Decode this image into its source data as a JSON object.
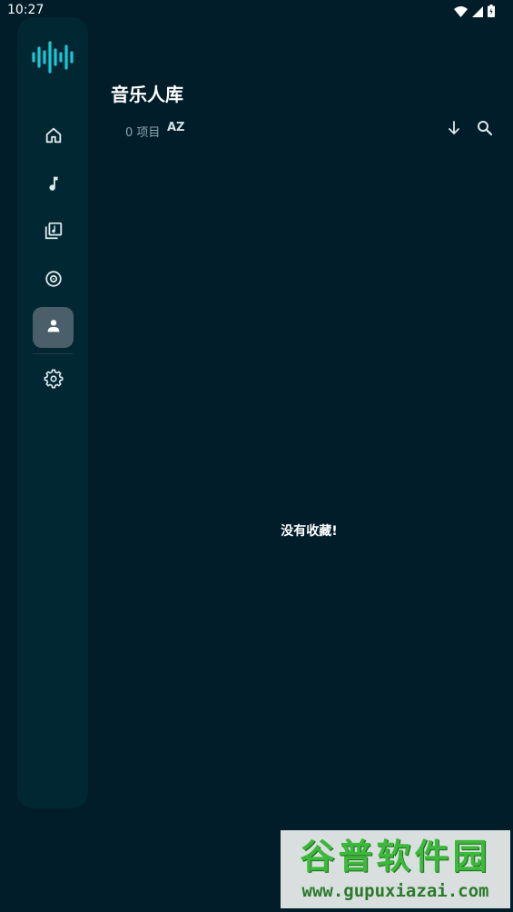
{
  "status_bar": {
    "time": "10:27",
    "icons": [
      "wifi-icon",
      "signal-icon",
      "battery-icon"
    ]
  },
  "sidebar": {
    "logo": "waveform-logo",
    "items": [
      {
        "id": "home",
        "icon": "home-icon",
        "active": false
      },
      {
        "id": "songs",
        "icon": "music-note-icon",
        "active": false
      },
      {
        "id": "playlists",
        "icon": "playlist-icon",
        "active": false
      },
      {
        "id": "albums",
        "icon": "album-icon",
        "active": false
      },
      {
        "id": "artists",
        "icon": "person-icon",
        "active": true
      },
      {
        "id": "settings",
        "icon": "gear-icon",
        "active": false
      }
    ]
  },
  "header": {
    "title": "音乐人库",
    "count": "0 项目",
    "sort_label": "AZ"
  },
  "toolbar": {
    "icons": [
      "arrow-down-icon",
      "search-icon"
    ]
  },
  "main": {
    "empty_message": "没有收藏!"
  },
  "watermark": {
    "title": "谷普软件园",
    "url": "www.gupuxiazai.com"
  },
  "colors": {
    "background": "#001d29",
    "sidebar": "#012733",
    "active_item": "#4a5f69",
    "accent": "#19c8d6"
  }
}
